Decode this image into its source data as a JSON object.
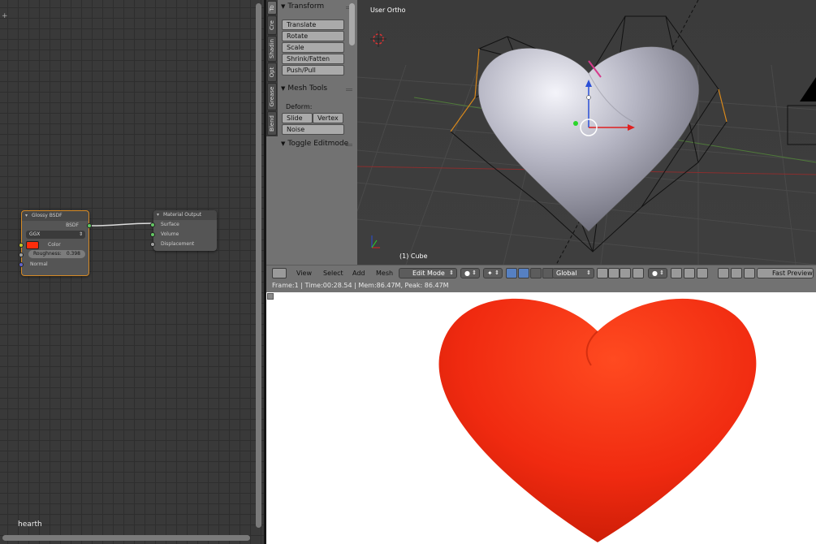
{
  "node_editor": {
    "corner_icon": "plus-icon",
    "footer_label": "hearth",
    "glossy_node": {
      "title": "Glossy BSDF",
      "output_socket": "BSDF",
      "distribution": "GGX",
      "color_label": "Color",
      "color_value": "#ff2d0b",
      "roughness_label": "Roughness:",
      "roughness_value": "0.398",
      "normal_label": "Normal"
    },
    "output_node": {
      "title": "Material Output",
      "inputs": [
        "Surface",
        "Volume",
        "Displacement"
      ]
    }
  },
  "tool_tabs": [
    "To",
    "Cre",
    "Shadin",
    "Opt",
    "Grease",
    "Blend"
  ],
  "tool_shelf": {
    "transform_title": "Transform",
    "transform_buttons": [
      "Translate",
      "Rotate",
      "Scale",
      "Shrink/Fatten",
      "Push/Pull"
    ],
    "mesh_tools_title": "Mesh Tools",
    "deform_label": "Deform:",
    "slide_edge": "Slide Ed",
    "vertex": "Vertex",
    "noise": "Noise",
    "toggle_editmode": "Toggle Editmode"
  },
  "viewport": {
    "title": "User Ortho",
    "object_label": "(1) Cube"
  },
  "header": {
    "menus": [
      "View",
      "Select",
      "Add",
      "Mesh"
    ],
    "mode": "Edit Mode",
    "orientation": "Global",
    "render_engine_button": "Fast Preview"
  },
  "render": {
    "status": "Frame:1 | Time:00:28.54 | Mem:86.47M, Peak: 86.47M",
    "heart_color": "#f02a10"
  }
}
